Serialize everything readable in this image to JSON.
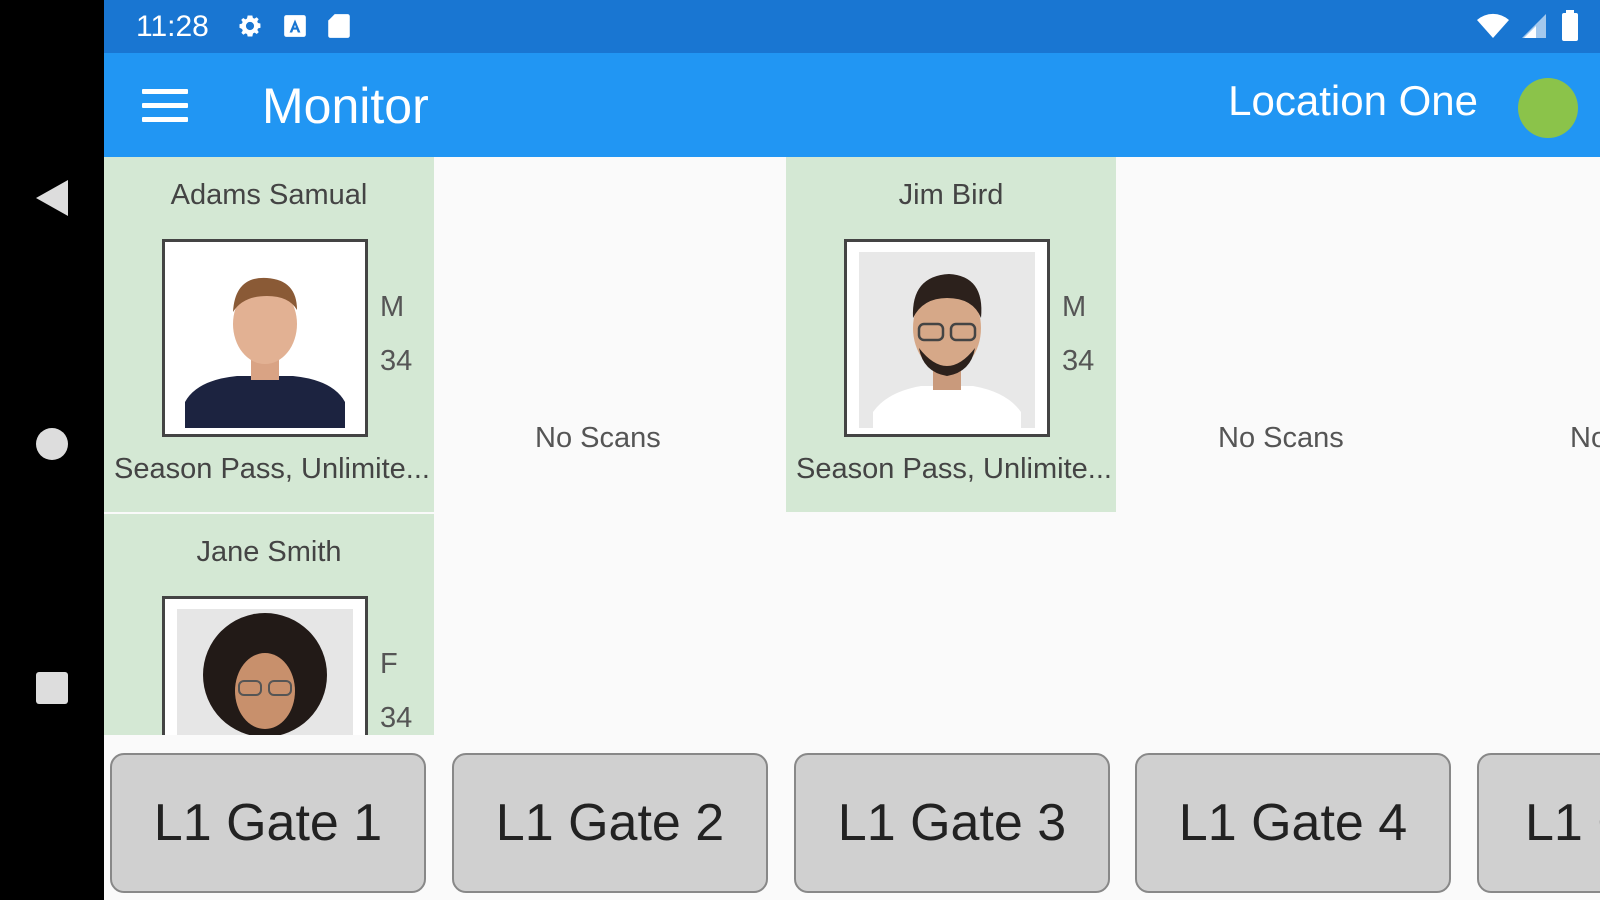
{
  "statusbar": {
    "time": "11:28"
  },
  "appbar": {
    "title": "Monitor",
    "location": "Location One",
    "status_color": "#8bc34a"
  },
  "colors": {
    "statusbar": "#1976d2",
    "appbar": "#2196f3",
    "card": "#d4e8d4"
  },
  "cards": [
    {
      "name": "Adams Samual",
      "gender": "M",
      "age": "34",
      "pass": "Season Pass, Unlimite..."
    },
    {
      "name": "Jim Bird",
      "gender": "M",
      "age": "34",
      "pass": "Season Pass, Unlimite..."
    },
    {
      "name": "Jane Smith",
      "gender": "F",
      "age": "34",
      "pass": ""
    }
  ],
  "no_scans": {
    "label": "No Scans",
    "partial": "No"
  },
  "gates": [
    "L1 Gate 1",
    "L1 Gate 2",
    "L1 Gate 3",
    "L1 Gate 4",
    "L1 G"
  ]
}
